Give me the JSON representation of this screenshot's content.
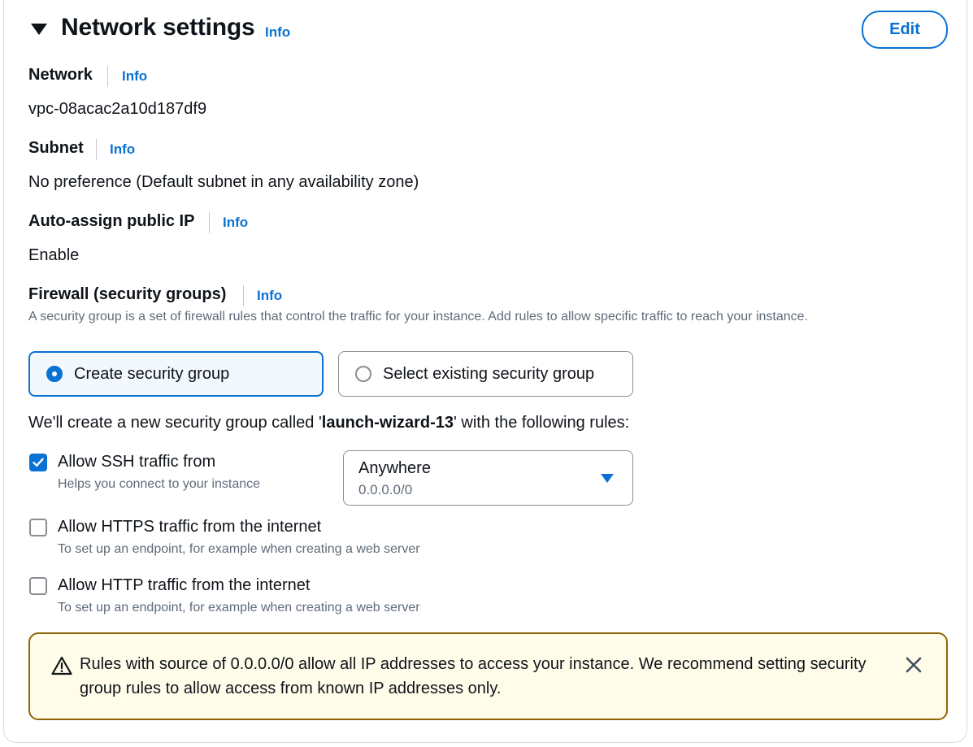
{
  "header": {
    "title": "Network settings",
    "info": "Info",
    "edit_label": "Edit"
  },
  "network": {
    "label": "Network",
    "info": "Info",
    "value": "vpc-08acac2a10d187df9"
  },
  "subnet": {
    "label": "Subnet",
    "info": "Info",
    "value": "No preference (Default subnet in any availability zone)"
  },
  "public_ip": {
    "label": "Auto-assign public IP",
    "info": "Info",
    "value": "Enable"
  },
  "firewall": {
    "label": "Firewall (security groups)",
    "info": "Info",
    "description": "A security group is a set of firewall rules that control the traffic for your instance. Add rules to allow specific traffic to reach your instance.",
    "options": [
      {
        "label": "Create security group",
        "selected": true
      },
      {
        "label": "Select existing security group",
        "selected": false
      }
    ]
  },
  "rules_intro": {
    "prefix": "We'll create a new security group called '",
    "group_name": "launch-wizard-13",
    "suffix": "' with the following rules:"
  },
  "rules": {
    "ssh": {
      "title": "Allow SSH traffic from",
      "description": "Helps you connect to your instance",
      "checked": true
    },
    "ssh_source": {
      "selected": "Anywhere",
      "sub": "0.0.0.0/0"
    },
    "https": {
      "title": "Allow HTTPS traffic from the internet",
      "description": "To set up an endpoint, for example when creating a web server",
      "checked": false
    },
    "http": {
      "title": "Allow HTTP traffic from the internet",
      "description": "To set up an endpoint, for example when creating a web server",
      "checked": false
    }
  },
  "warning": {
    "text": "Rules with source of 0.0.0.0/0 allow all IP addresses to access your instance. We recommend setting security group rules to allow access from known IP addresses only."
  },
  "colors": {
    "accent": "#0972d3",
    "warning_border": "#8d6605",
    "warning_bg": "#fffce9"
  }
}
